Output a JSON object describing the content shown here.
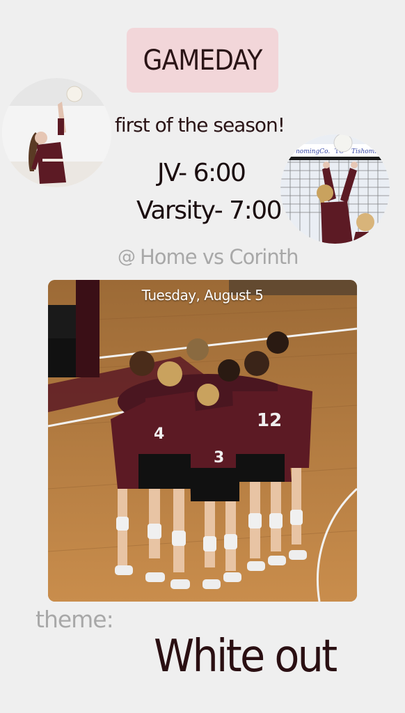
{
  "story": {
    "badge": "GAMEDAY",
    "subtitle": "first of the season!",
    "times": {
      "jv": "JV- 6:00",
      "varsity": "Varsity- 7:00"
    },
    "location": {
      "icon": "at-icon",
      "text": "Home vs Corinth"
    },
    "photo": {
      "date": "Tuesday, August 5",
      "right_circle_banner_left": "nomingCo.",
      "right_circle_banner_mid": "TC",
      "right_circle_banner_right": "Tishoming"
    },
    "theme": {
      "label": "theme:",
      "value": "White out"
    }
  },
  "colors": {
    "background": "#efefef",
    "badge_bg": "#f2d6d9",
    "maroon": "#5c1a24",
    "muted_text": "#a8a8a8",
    "dark_text": "#1a0c0e"
  }
}
